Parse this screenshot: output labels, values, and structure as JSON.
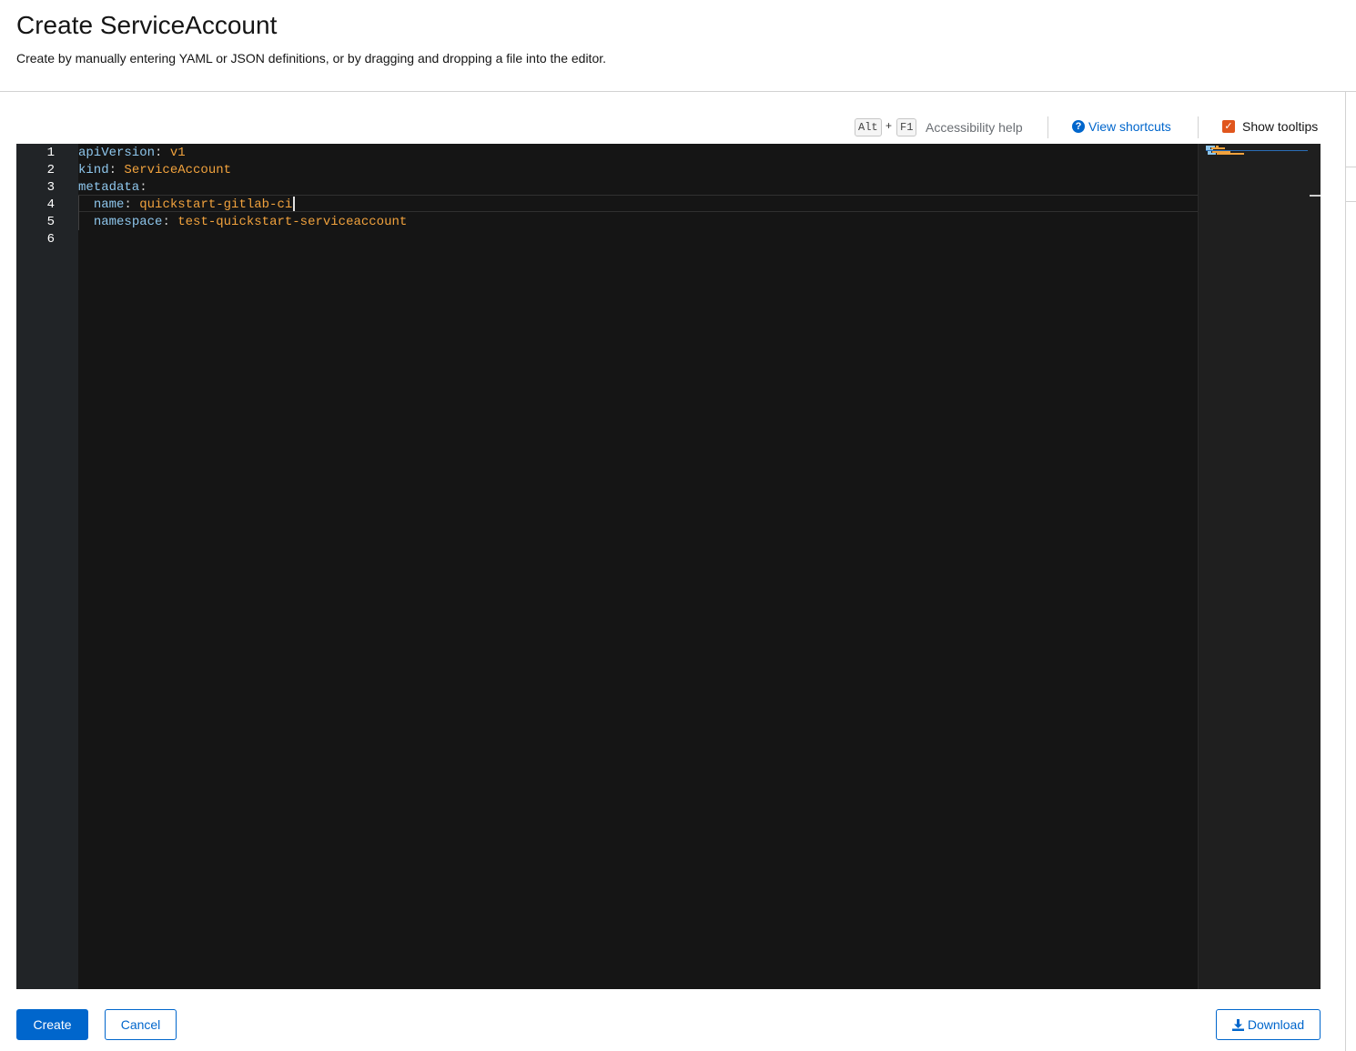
{
  "header": {
    "title": "Create ServiceAccount",
    "description": "Create by manually entering YAML or JSON definitions, or by dragging and dropping a file into the editor."
  },
  "toolbar": {
    "key_alt": "Alt",
    "key_plus": "+",
    "key_f1": "F1",
    "accessibility_help": "Accessibility help",
    "view_shortcuts": "View shortcuts",
    "show_tooltips": "Show tooltips",
    "show_tooltips_checked": true
  },
  "editor": {
    "line_numbers": [
      "1",
      "2",
      "3",
      "4",
      "5",
      "6"
    ],
    "lines": [
      {
        "indent": "",
        "key": "apiVersion",
        "colon": ": ",
        "value": "v1"
      },
      {
        "indent": "",
        "key": "kind",
        "colon": ": ",
        "value": "ServiceAccount"
      },
      {
        "indent": "",
        "key": "metadata",
        "colon": ":",
        "value": ""
      },
      {
        "indent": "  ",
        "key": "name",
        "colon": ": ",
        "value": "quickstart-gitlab-ci"
      },
      {
        "indent": "  ",
        "key": "namespace",
        "colon": ": ",
        "value": "test-quickstart-serviceaccount"
      }
    ],
    "cursor_line": 4,
    "colors": {
      "background": "#151515",
      "gutter": "#212427",
      "key": "#8ec6ec",
      "value": "#f1a23d"
    }
  },
  "actions": {
    "create": "Create",
    "cancel": "Cancel",
    "download": "Download"
  },
  "colors": {
    "primary": "#0066cc",
    "checkbox": "#e0561d"
  }
}
